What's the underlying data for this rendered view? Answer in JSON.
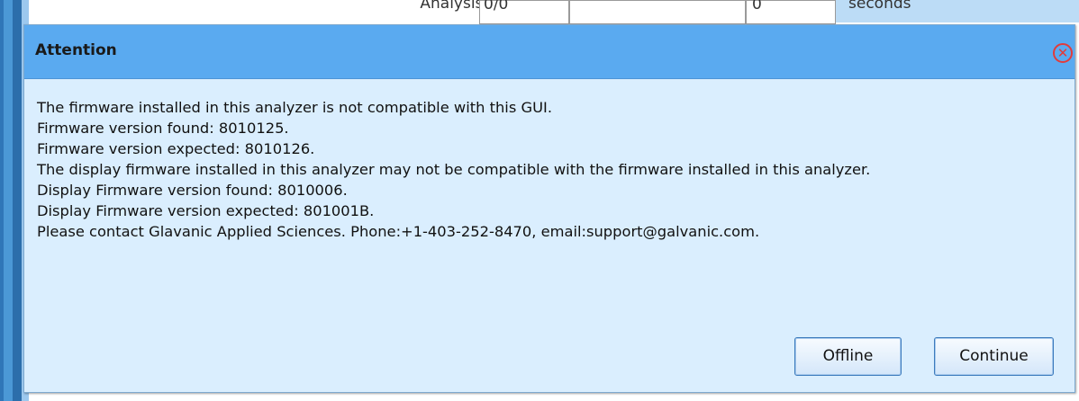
{
  "background": {
    "row_label": "Analysis Status",
    "field1_value": "0/0",
    "field3_value": "0",
    "units": "seconds"
  },
  "dialog": {
    "title": "Attention",
    "close_icon": "close-circle-icon",
    "message_lines": [
      "The firmware installed in this analyzer is not compatible with this GUI.",
      "Firmware version found: 8010125.",
      "Firmware version expected: 8010126.",
      "The display firmware installed in this analyzer may not be compatible with the firmware installed in this analyzer.",
      "Display Firmware version found: 8010006.",
      "Display Firmware version expected: 801001B.",
      "Please contact Glavanic Applied Sciences. Phone:+1-403-252-8470, email:support@galvanic.com."
    ],
    "buttons": {
      "offline": "Offline",
      "continue": "Continue"
    }
  },
  "colors": {
    "titlebar": "#5aaaf0",
    "dialog_bg": "#daeefe",
    "close_red": "#e23b3b"
  }
}
